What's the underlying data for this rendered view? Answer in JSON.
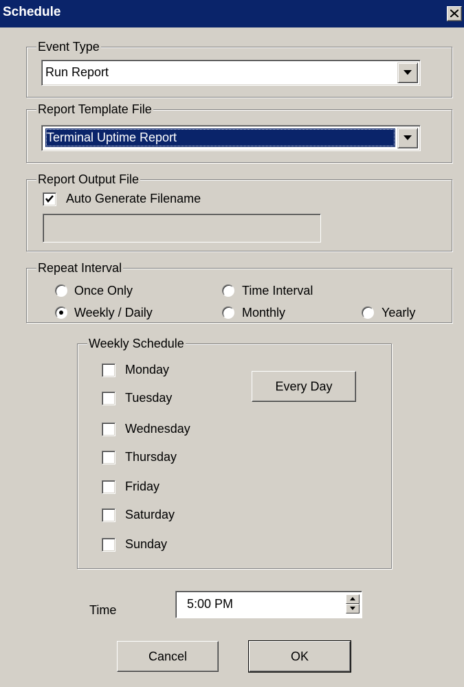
{
  "window": {
    "title": "Schedule"
  },
  "event_type": {
    "legend": "Event Type",
    "selected": "Run Report"
  },
  "report_template": {
    "legend": "Report Template File",
    "selected": "Terminal Uptime Report"
  },
  "report_output": {
    "legend": "Report Output File",
    "auto_generate_label": "Auto Generate Filename",
    "auto_generate_checked": true,
    "filename_value": ""
  },
  "repeat_interval": {
    "legend": "Repeat Interval",
    "options": [
      "Once Only",
      "Time Interval",
      "Weekly / Daily",
      "Monthly",
      "Yearly"
    ],
    "selected": "Weekly / Daily"
  },
  "weekly_schedule": {
    "legend": "Weekly Schedule",
    "days": [
      "Monday",
      "Tuesday",
      "Wednesday",
      "Thursday",
      "Friday",
      "Saturday",
      "Sunday"
    ],
    "every_day_label": "Every Day"
  },
  "time": {
    "label": "Time",
    "value": "5:00 PM"
  },
  "buttons": {
    "cancel": "Cancel",
    "ok": "OK"
  }
}
